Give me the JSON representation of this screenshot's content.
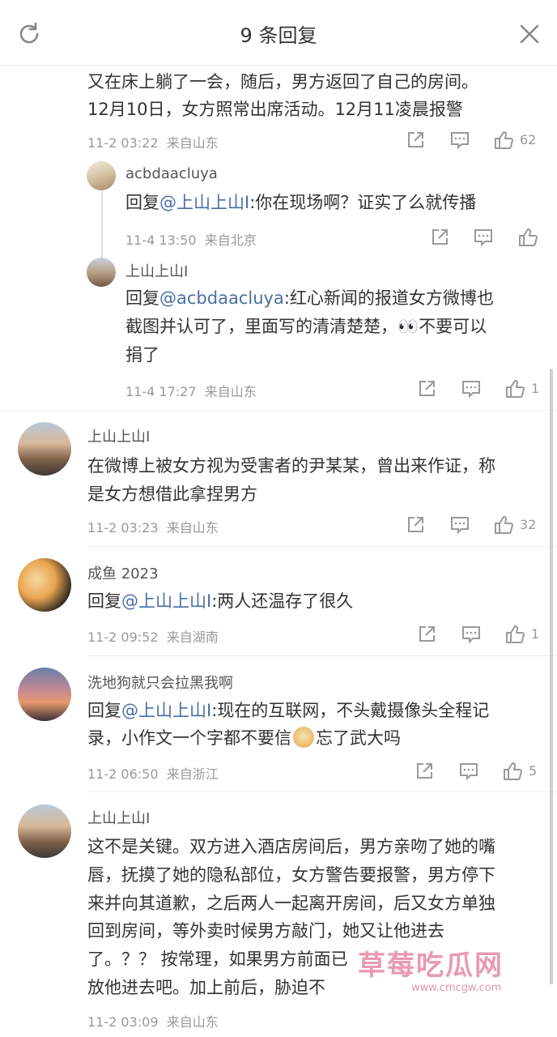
{
  "header": {
    "title": "9 条回复"
  },
  "comments": [
    {
      "text_lines": [
        "又在床上躺了一会，随后，男方返回了自己的房间。",
        "12月10日，女方照常出席活动。12月11凌晨报警"
      ],
      "time": "11-2 03:22",
      "location": "来自山东",
      "likes": "62"
    }
  ],
  "nested": [
    {
      "name": "acbdaacluya",
      "reply_prefix": "回复",
      "reply_to": "@上山上山I",
      "text": ":你在现场啊？证实了么就传播",
      "time": "11-4 13:50",
      "location": "来自北京",
      "likes": ""
    },
    {
      "name": "上山上山I",
      "reply_prefix": "回复",
      "reply_to": "@acbdaacluya",
      "line1": ":红心新闻的报道女方微博也",
      "line2": "截图并认可了，里面写的清清楚楚，",
      "emoji": "👀",
      "line2b": "不要可以",
      "line3": "捐了",
      "time": "11-4 17:27",
      "location": "来自山东",
      "likes": "1"
    }
  ],
  "main": [
    {
      "name": "上山上山I",
      "lines": [
        "在微博上被女方视为受害者的尹某某，曾出来作证，称",
        "是女方想借此拿捏男方"
      ],
      "time": "11-2 03:23",
      "location": "来自山东",
      "likes": "32"
    },
    {
      "name": "成鱼 2023",
      "reply_prefix": "回复",
      "reply_to": "@上山上山I",
      "text": ":两人还温存了很久",
      "time": "11-2 09:52",
      "location": "来自湖南",
      "likes": "1"
    },
    {
      "name": "洗地狗就只会拉黑我啊",
      "reply_prefix": "回复",
      "reply_to": "@上山上山I",
      "line1": ":现在的互联网，不头戴摄像头全程记",
      "line2": "录，小作文一个字都不要信",
      "line2b": "忘了武大吗",
      "time": "11-2 06:50",
      "location": "来自浙江",
      "likes": "5"
    },
    {
      "name": "上山上山I",
      "lines": [
        "这不是关键。双方进入酒店房间后，男方亲吻了她的嘴",
        "唇，抚摸了她的隐私部位，女方警告要报警，男方停下",
        "来并向其道歉，之后两人一起离开房间，后又女方单独",
        "回到房间，等外卖时候男方敲门，她又让他进去",
        "了。？？ 按常理，如果男方前面已",
        "放他进去吧。加上前后，胁迫不"
      ],
      "time": "11-2 03:09",
      "location": "来自山东",
      "likes": ""
    }
  ],
  "watermark": {
    "text": "草莓吃瓜网",
    "url": "www.cmcgw.com"
  },
  "colors": {
    "link": "#4a6fa5",
    "meta": "#999999",
    "divider": "#eeeeee"
  }
}
